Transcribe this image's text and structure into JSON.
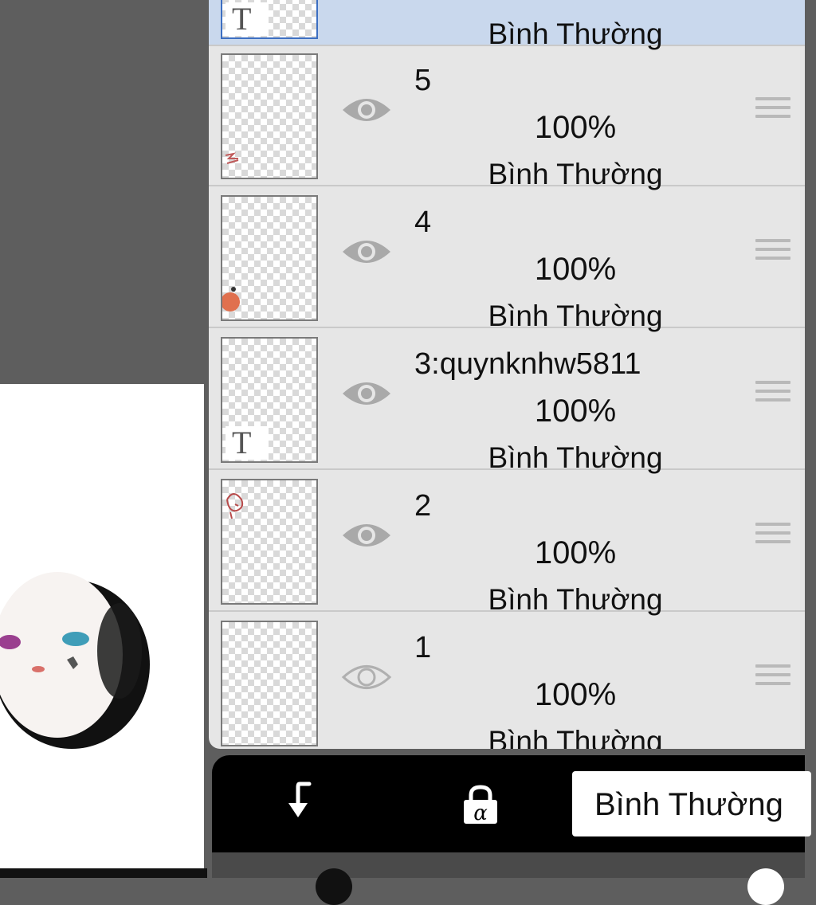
{
  "layers": [
    {
      "name": "",
      "opacity": "",
      "blend": "Bình Thường",
      "visible": true,
      "selected": true,
      "thumb_icon": "text-layer-icon"
    },
    {
      "name": "5",
      "opacity": "100%",
      "blend": "Bình Thường",
      "visible": true,
      "selected": false,
      "thumb_icon": "sketch-thumbnail"
    },
    {
      "name": "4",
      "opacity": "100%",
      "blend": "Bình Thường",
      "visible": true,
      "selected": false,
      "thumb_icon": "color-blob-thumbnail"
    },
    {
      "name": "3:quynknhw5811",
      "opacity": "100%",
      "blend": "Bình Thường",
      "visible": true,
      "selected": false,
      "thumb_icon": "text-layer-icon"
    },
    {
      "name": "2",
      "opacity": "100%",
      "blend": "Bình Thường",
      "visible": true,
      "selected": false,
      "thumb_icon": "sketch-thumbnail"
    },
    {
      "name": "1",
      "opacity": "100%",
      "blend": "Bình Thường",
      "visible": false,
      "selected": false,
      "thumb_icon": "blank-thumbnail"
    }
  ],
  "text_thumb_glyph": "T",
  "toolbar": {
    "clip_icon": "clipping-arrow-icon",
    "alpha_lock_icon": "alpha-lock-icon",
    "alpha_glyph": "α",
    "blend_mode_value": "Bình Thường"
  },
  "colors": {
    "selected_row": "#c9d8ed",
    "panel_bg": "#e6e6e6",
    "canvas_bg": "#5e5e5e",
    "toolbar_bg": "#000000"
  }
}
